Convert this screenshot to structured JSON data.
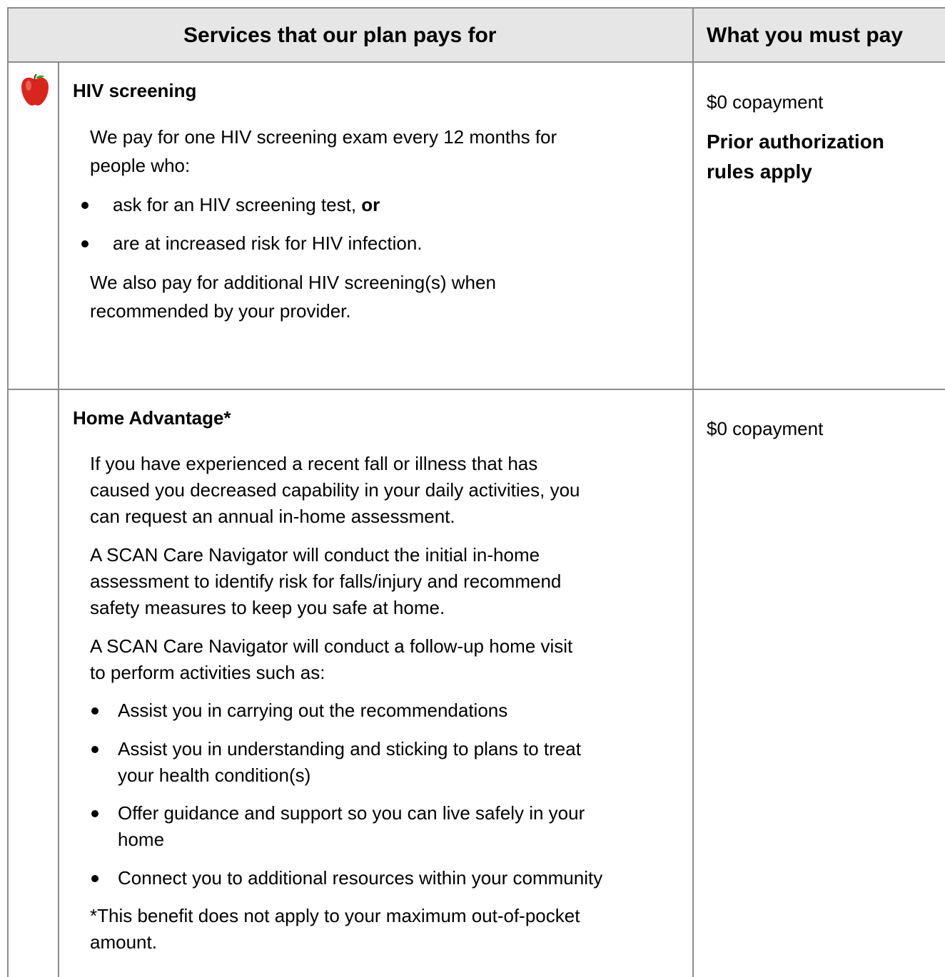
{
  "header": {
    "services_col": "Services that our plan pays for",
    "pay_col": "What you must pay"
  },
  "rows": [
    {
      "icon": "apple-icon",
      "title": "HIV screening",
      "intro": [
        "We pay for one HIV screening exam every 12 months for",
        "people who:"
      ],
      "bullets": [
        {
          "text": "ask for an HIV screening test, ",
          "bold": "or"
        },
        {
          "text": "are at increased risk for HIV infection."
        }
      ],
      "outro": [
        "We also pay for additional HIV screening(s) when",
        "recommended by your provider."
      ],
      "copay": "$0 copayment",
      "note_lines": [
        "Prior authorization",
        "rules apply"
      ]
    },
    {
      "title": "Home Advantage*",
      "para1": [
        "If you have experienced a recent fall or illness that has",
        "caused you decreased capability in your daily activities, you",
        "can request an annual in-home assessment."
      ],
      "para2": [
        "A SCAN Care Navigator will conduct the initial in-home",
        "assessment to identify risk for falls/injury and recommend",
        "safety measures to keep you safe at home."
      ],
      "para3": [
        "A SCAN Care Navigator will conduct a follow-up home visit",
        "to perform activities such as:"
      ],
      "bullets": [
        [
          "Assist you in carrying out the recommendations"
        ],
        [
          "Assist you in understanding and sticking to plans to treat",
          "your health condition(s)"
        ],
        [
          "Offer guidance and support so you can live safely in your",
          "home"
        ],
        [
          "Connect you to additional resources within your community"
        ]
      ],
      "footnote": [
        "*This benefit does not apply to your maximum out-of-pocket",
        "amount."
      ],
      "copay": "$0 copayment"
    }
  ],
  "colors": {
    "header_bg": "#e6e6e6",
    "border": "#8c8c8c",
    "apple_red": "#d7261e"
  }
}
